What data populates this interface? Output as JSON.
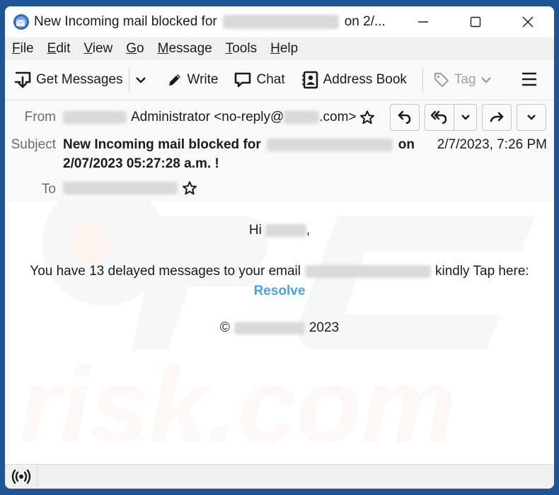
{
  "window": {
    "title_prefix": "New Incoming mail blocked for",
    "title_suffix": "on 2/...",
    "controls": [
      "minimize",
      "maximize",
      "close"
    ]
  },
  "menu": {
    "items": [
      {
        "label_first": "F",
        "label_rest": "ile"
      },
      {
        "label_first": "E",
        "label_rest": "dit"
      },
      {
        "label_first": "V",
        "label_rest": "iew"
      },
      {
        "label_first": "G",
        "label_rest": "o"
      },
      {
        "label_first": "M",
        "label_rest": "essage"
      },
      {
        "label_first": "T",
        "label_rest": "ools"
      },
      {
        "label_first": "H",
        "label_rest": "elp"
      }
    ]
  },
  "toolbar": {
    "get_messages": "Get Messages",
    "write": "Write",
    "chat": "Chat",
    "address_book": "Address Book",
    "tag": "Tag"
  },
  "header": {
    "from_label": "From",
    "from_name": "Administrator <no-reply@",
    "from_domain_suffix": ".com>",
    "subject_label": "Subject",
    "subject_line1_prefix": "New Incoming mail blocked for",
    "subject_line1_suffix": "on",
    "subject_line2": "2/07/2023 05:27:28 a.m. !",
    "to_label": "To",
    "date": "2/7/2023, 7:26 PM"
  },
  "body": {
    "greeting_prefix": "Hi",
    "greeting_suffix": ",",
    "message_prefix": "You have 13 delayed messages to your email",
    "message_suffix": "kindly Tap here:",
    "link": "Resolve",
    "copyright_symbol": "©",
    "copyright_year": "2023"
  },
  "watermark": {
    "text": "risk.com",
    "logo": "PC"
  },
  "colors": {
    "link": "#4aa3df",
    "desktop": "#1f5596"
  }
}
